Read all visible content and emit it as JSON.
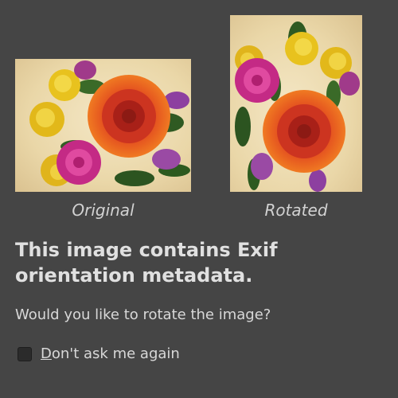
{
  "dialog": {
    "original_caption": "Original",
    "rotated_caption": "Rotated",
    "heading": "This image contains Exif orientation metadata.",
    "question": "Would you like to rotate the image?",
    "dont_ask": {
      "mnemonic": "D",
      "rest": "on't ask me again",
      "checked": false
    }
  },
  "images": {
    "original": "flower-bouquet-photo",
    "rotated": "flower-bouquet-photo-rotated"
  },
  "colors": {
    "background": "#454545",
    "text": "#dcdcdc"
  }
}
